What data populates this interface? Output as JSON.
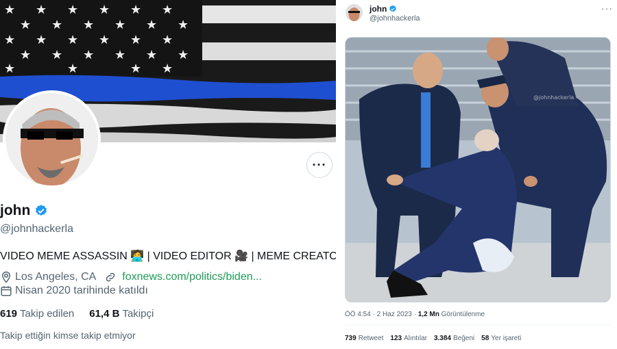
{
  "profile": {
    "name": "john",
    "handle": "@johnhackerla",
    "bio": "VIDEO MEME ASSASSIN 🧑‍💻 | VIDEO EDITOR 🎥 | MEME CREATOR 🇺🇸",
    "location": "Los Angeles, CA",
    "website": "foxnews.com/politics/biden...",
    "joined": "Nisan 2020 tarihinde katıldı",
    "following_count": "619",
    "following_label": "Takip edilen",
    "followers_count": "61,4 B",
    "followers_label": "Takipçi",
    "no_mutuals": "Takip ettiğin kimse takip etmiyor",
    "more_icon": "more-horizontal-icon",
    "verified_color": "#1d9bf0"
  },
  "tweet": {
    "name": "john",
    "handle": "@johnhackerla",
    "more_label": "···",
    "time": "ÖÖ 4:54 · 2 Haz 2023 ·",
    "views_count": "1,2 Mn",
    "views_label": "Görüntülenme",
    "retweets_count": "739",
    "retweets_label": "Retweet",
    "quotes_count": "123",
    "quotes_label": "Alıntılar",
    "likes_count": "3.384",
    "likes_label": "Beğeni",
    "bookmarks_count": "58",
    "bookmarks_label": "Yer işareti"
  },
  "colors": {
    "link": "#1d9b55",
    "secondary_text": "#536471",
    "thin_blue_line": "#1f4fd1"
  }
}
